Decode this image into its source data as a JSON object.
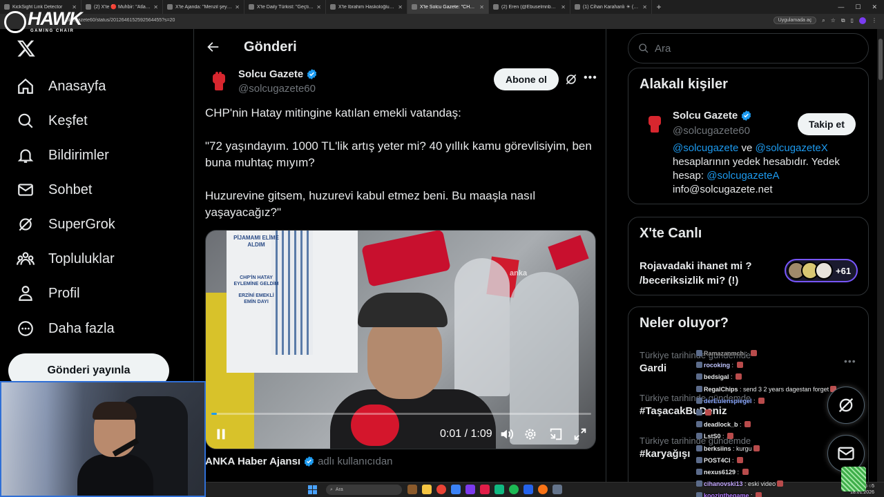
{
  "browser": {
    "tabs": [
      {
        "label": "KickSight Link Detector",
        "active": false
      },
      {
        "label": "(2) X'te 🔴 Muhbir: \"Atlas'ın anne...",
        "active": false
      },
      {
        "label": "X'te Ajanda: \"Menzil şeyhinin b...",
        "active": false
      },
      {
        "label": "X'te Daily Türkist: \"Geçtiğimiz a...",
        "active": false
      },
      {
        "label": "X'te İbrahim Haskoloğlu: \"El Sa...",
        "active": false
      },
      {
        "label": "X'te Solcu Gazete: \"CHP'ni...",
        "active": true
      },
      {
        "label": "(2) Eren (@Ebuselmnbelarus) / ...",
        "active": false
      },
      {
        "label": "(1) Cihan Karahanlı ☀ (@karahan...",
        "active": false
      }
    ],
    "url": "olcugazete60/status/2012646152592564455?s=20",
    "open_in_app": "Uygulamada aç"
  },
  "overlay": {
    "brand": "HAWK",
    "brand_sub": "GAMING CHAIR"
  },
  "nav": {
    "items": [
      {
        "label": "Anasayfa",
        "icon": "home-icon"
      },
      {
        "label": "Keşfet",
        "icon": "search-icon"
      },
      {
        "label": "Bildirimler",
        "icon": "bell-icon"
      },
      {
        "label": "Sohbet",
        "icon": "mail-icon"
      },
      {
        "label": "SuperGrok",
        "icon": "grok-icon"
      },
      {
        "label": "Topluluklar",
        "icon": "communities-icon"
      },
      {
        "label": "Profil",
        "icon": "profile-icon"
      },
      {
        "label": "Daha fazla",
        "icon": "more-circle-icon"
      }
    ],
    "post_button": "Gönderi yayınla"
  },
  "post": {
    "header_title": "Gönderi",
    "author_name": "Solcu Gazete",
    "author_handle": "@solcugazete60",
    "follow_label": "Abone ol",
    "paragraphs": [
      "CHP'nin Hatay mitingine katılan emekli vatandaş:",
      "\"72 yaşındayım. 1000 TL'lik artış yeter mi? 40 yıllık kamu görevlisiyim, ben buna muhtaç mıyım?",
      "Huzurevine gitsem, huzurevi kabul etmez beni. Bu maaşla nasıl yaşayacağız?\""
    ],
    "video": {
      "sign_line1": "PİJAMAMI ELİME ALDIM",
      "sign_line2": "CHP'İN HATAY EYLEMİNE GELDİM",
      "sign_line3": "ERZİNİ EMEKLİ EMİN DAYI",
      "watermark": "anka",
      "time": "0:01 / 1:09",
      "progress": 0.015
    },
    "source_name": "ANKA Haber Ajansı",
    "source_suffix": "adlı kullanıcıdan"
  },
  "right": {
    "search_placeholder": "Ara",
    "related_title": "Alakalı kişiler",
    "related": {
      "name": "Solcu Gazete",
      "handle": "@solcugazete60",
      "follow_label": "Takip et",
      "bio_link1": "@solcugazete",
      "bio_and": " ve ",
      "bio_link2": "@solcugazeteX",
      "bio_mid": " hesaplarının yedek hesabıdır. Yedek hesap: ",
      "bio_link3": "@solcugazeteA",
      "bio_email": "info@solcugazete.net"
    },
    "live_title": "X'te Canlı",
    "live_text": "Rojavadaki ihanet mi ? /beceriksizlik mi?  (!)",
    "live_count": "+61",
    "trends_title": "Neler oluyor?",
    "trends": [
      {
        "context": "Türkiye tarihinde gündemde",
        "topic": "Gardi"
      },
      {
        "context": "Türkiye tarihinde gündemde",
        "topic": "#TaşacakBuDeniz"
      },
      {
        "context": "Türkiye tarihinde gündemde",
        "topic": "#karyağışı"
      }
    ]
  },
  "chat": [
    {
      "user": "Ramazanmch",
      "msg": "",
      "color": "#9e9e9e"
    },
    {
      "user": "rocoking",
      "msg": "",
      "color": "#c0c6ff"
    },
    {
      "user": "bedsigal",
      "msg": "",
      "color": "#e7e9ea"
    },
    {
      "user": "RegalChips",
      "msg": "send 3 2 years dagestan forget",
      "color": "#e7e9ea"
    },
    {
      "user": "derEulenspiegel",
      "msg": "",
      "color": "#8aa8ff"
    },
    {
      "user": "",
      "msg": "",
      "color": "#e7e9ea"
    },
    {
      "user": "deadlock_b",
      "msg": "",
      "color": "#e7e9ea"
    },
    {
      "user": "LstS0",
      "msg": "",
      "color": "#e7e9ea"
    },
    {
      "user": "berksiins",
      "msg": "kurgu",
      "color": "#e7e9ea"
    },
    {
      "user": "POST4CI",
      "msg": "",
      "color": "#e7e9ea"
    },
    {
      "user": "nexus6129",
      "msg": "",
      "color": "#e7e9ea"
    },
    {
      "user": "cihanovski13",
      "msg": "eski video",
      "color": "#c4a8ff"
    },
    {
      "user": "koozinthegame",
      "msg": "",
      "color": "#b57bff"
    }
  ],
  "taskbar": {
    "search": "Ara",
    "time": "20:15 ○5",
    "date": "18.01.2026"
  },
  "colors": {
    "accent": "#1d9bf0",
    "background": "#000000",
    "border": "#2f3336",
    "muted": "#71767b",
    "live_ring": "#7856ff"
  }
}
